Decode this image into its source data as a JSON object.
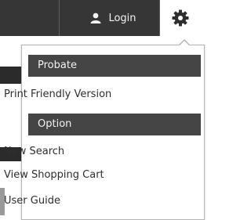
{
  "header": {
    "login_label": "Login",
    "user_icon": "user-icon",
    "settings_icon": "gear-icon"
  },
  "dropdown": {
    "sections": [
      {
        "title": "Probate",
        "items": [
          "Print Friendly Version"
        ]
      },
      {
        "title": "Option",
        "items": [
          "New Search",
          "View Shopping Cart",
          "User Guide"
        ]
      }
    ]
  },
  "colors": {
    "topbar": "#363636",
    "section_header": "#454545",
    "text": "#2e2e2e"
  }
}
